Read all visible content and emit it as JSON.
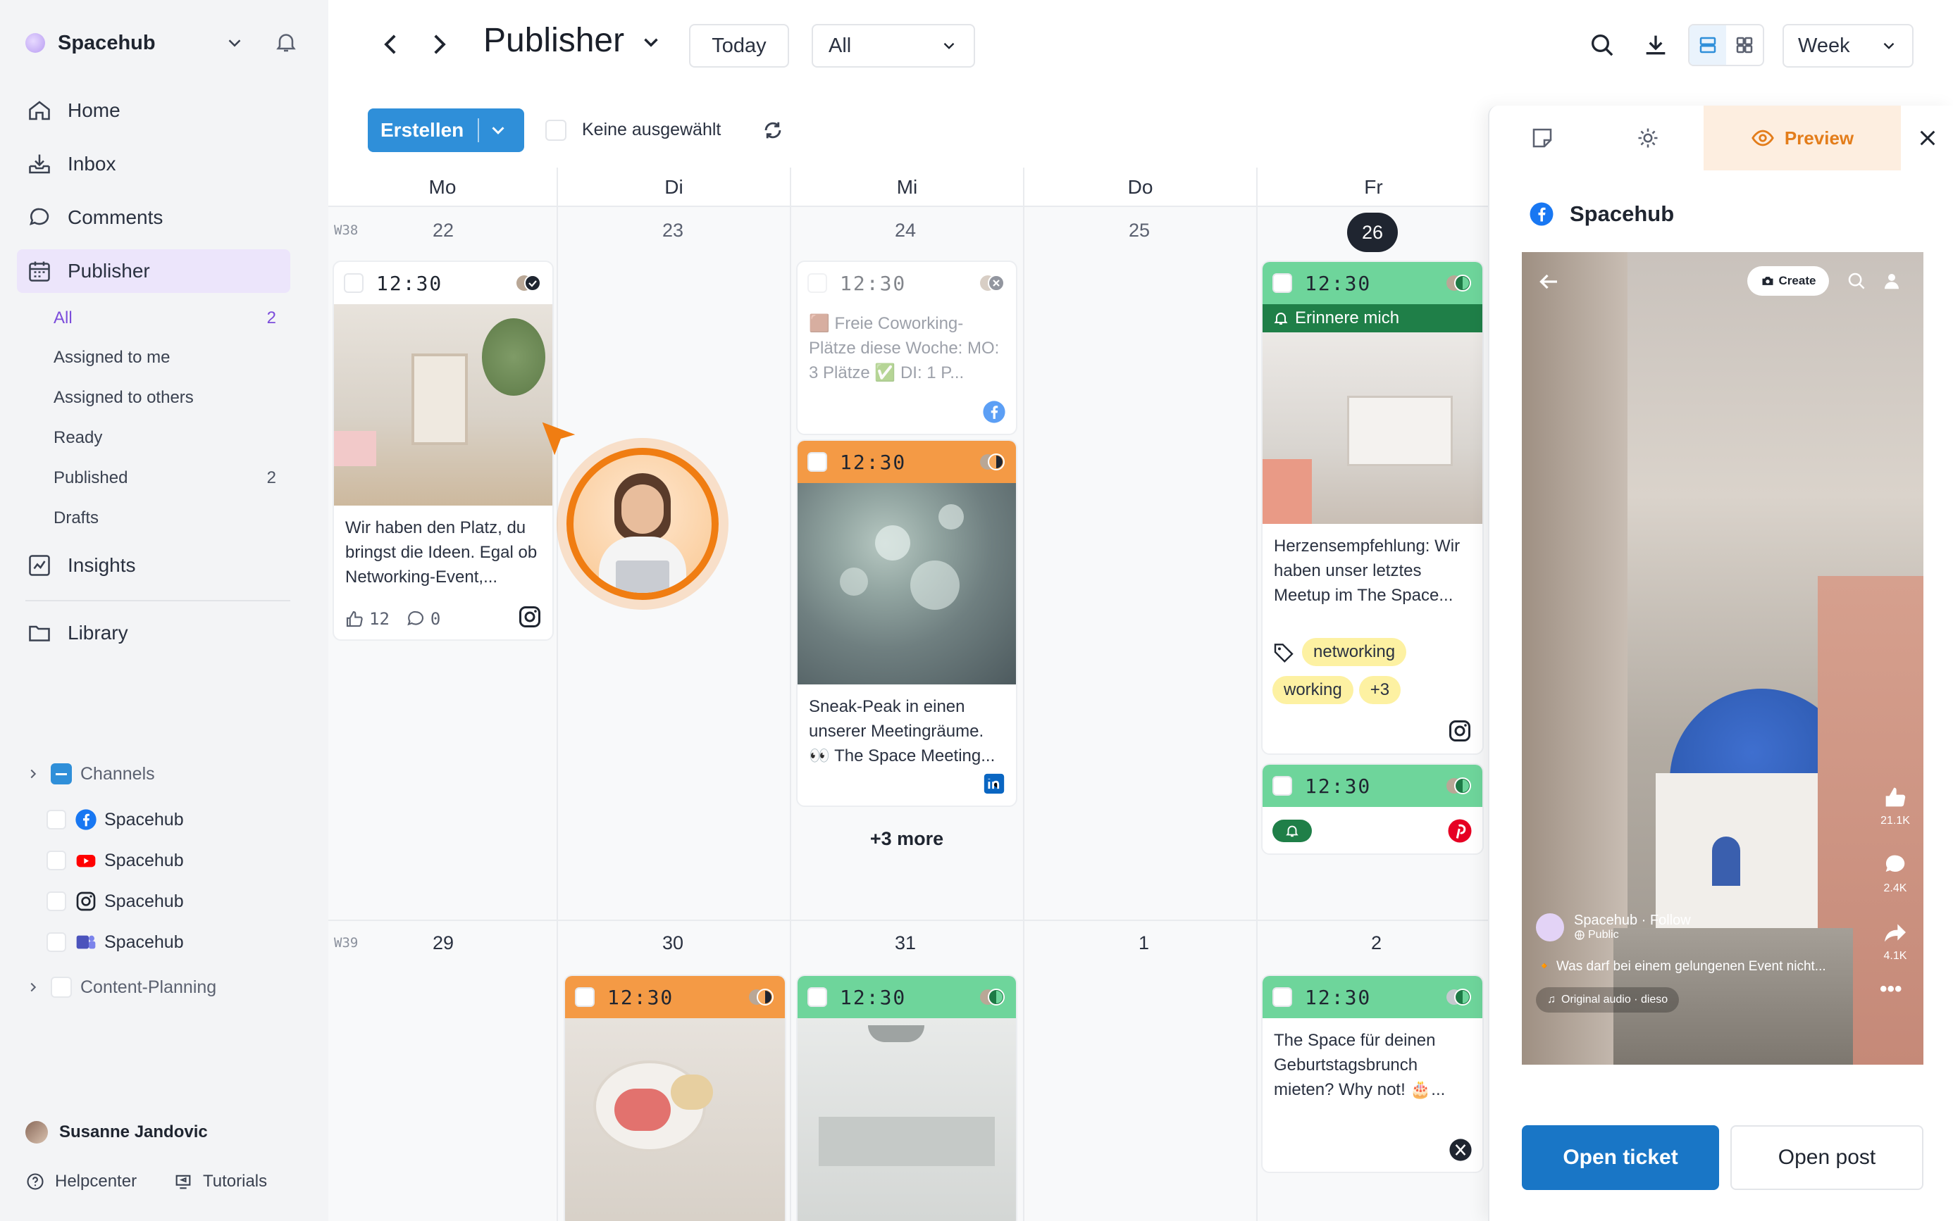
{
  "sidebar": {
    "workspace": "Spacehub",
    "nav": {
      "home": "Home",
      "inbox": "Inbox",
      "comments": "Comments",
      "publisher": "Publisher",
      "insights": "Insights",
      "library": "Library"
    },
    "sub": [
      {
        "label": "All",
        "count": "2"
      },
      {
        "label": "Assigned to me",
        "count": ""
      },
      {
        "label": "Assigned to others",
        "count": ""
      },
      {
        "label": "Ready",
        "count": ""
      },
      {
        "label": "Published",
        "count": "2"
      },
      {
        "label": "Drafts",
        "count": ""
      }
    ],
    "channels_label": "Channels",
    "channels": [
      {
        "name": "Spacehub",
        "network": "facebook"
      },
      {
        "name": "Spacehub",
        "network": "youtube"
      },
      {
        "name": "Spacehub",
        "network": "instagram"
      },
      {
        "name": "Spacehub",
        "network": "teams"
      }
    ],
    "content_planning": "Content-Planning",
    "user": "Susanne Jandovic",
    "helpcenter": "Helpcenter",
    "tutorials": "Tutorials"
  },
  "topbar": {
    "title": "Publisher",
    "today": "Today",
    "filter": "All",
    "view": "Week"
  },
  "actions": {
    "create": "Erstellen",
    "none_selected": "Keine ausgewählt"
  },
  "calendar": {
    "days": [
      "Mo",
      "Di",
      "Mi",
      "Do",
      "Fr"
    ],
    "week1": "W38",
    "week2": "W39",
    "dates1": [
      "22",
      "23",
      "24",
      "25",
      "26"
    ],
    "dates2": [
      "29",
      "30",
      "31",
      "1",
      "2"
    ],
    "posts": {
      "mo22": {
        "time": "12:30",
        "text": "Wir haben den Platz, du bringst die Ideen. Egal ob Networking-Event,...",
        "likes": "12",
        "comments": "0"
      },
      "mi24a": {
        "time": "12:30",
        "text": "🟫 Freie Coworking-Plätze diese Woche: MO: 3 Plätze ✅ DI: 1 P..."
      },
      "mi24b": {
        "time": "12:30",
        "text": "Sneak-Peak in einen unserer Meetingräume. 👀 The Space Meeting..."
      },
      "more": "+3 more",
      "fr26a": {
        "time": "12:30",
        "reminder": "Erinnere mich",
        "text": "Herzensempfehlung: Wir haben unser letztes Meetup im The Space...",
        "tags": [
          "networking",
          "working",
          "+3"
        ]
      },
      "fr26b": {
        "time": "12:30"
      },
      "di30": {
        "time": "12:30"
      },
      "mi31": {
        "time": "12:30"
      },
      "fr2": {
        "time": "12:30",
        "text": "The Space für deinen Geburtstagsbrunch mieten? Why not! 🎂..."
      }
    }
  },
  "panel": {
    "preview_tab": "Preview",
    "account": "Spacehub",
    "phone": {
      "create": "Create",
      "account": "Spacehub",
      "follow": "Follow",
      "public": "Public",
      "caption": "Was darf bei einem gelungenen Event nicht...",
      "audio": "Original audio · dieso",
      "likes": "21.1K",
      "comments": "2.4K",
      "shares": "4.1K"
    },
    "open_ticket": "Open ticket",
    "open_post": "Open post"
  },
  "colors": {
    "accent": "#7c4ddb",
    "primary": "#2f8fd9",
    "orange": "#f49a45",
    "green": "#6ed59b"
  }
}
